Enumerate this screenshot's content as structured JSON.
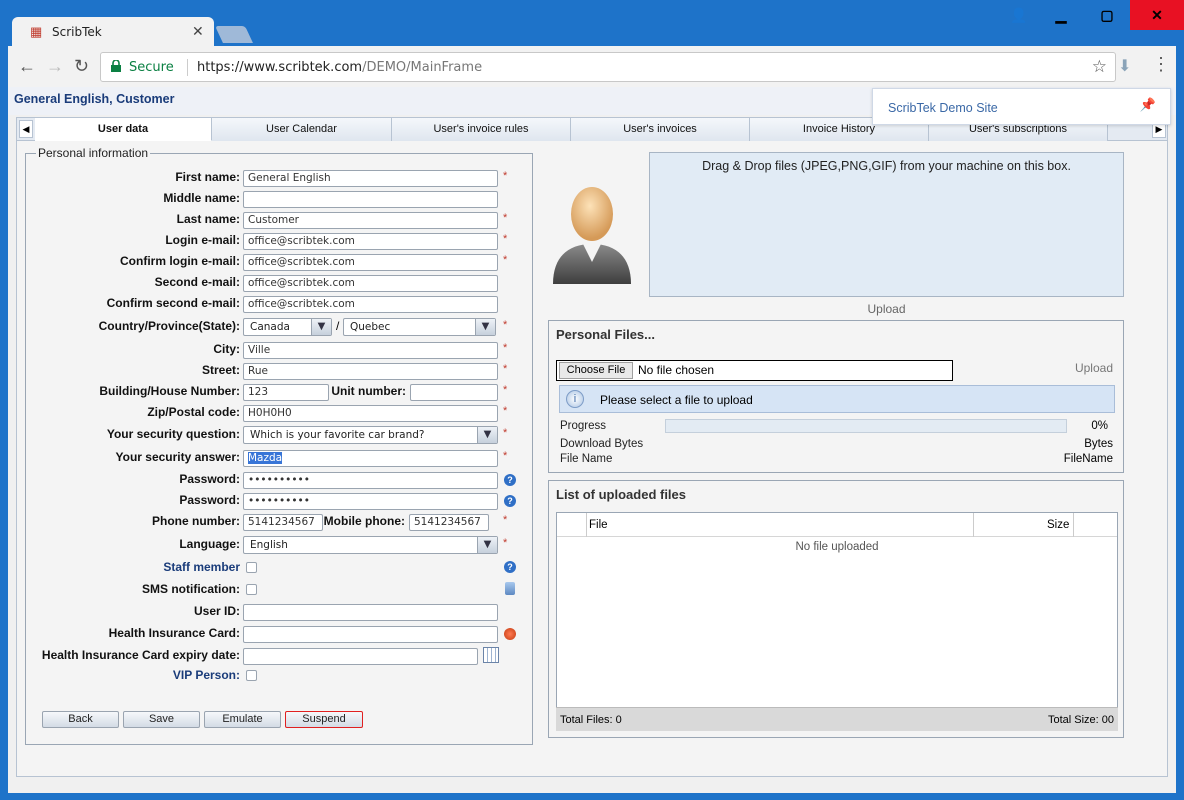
{
  "browser": {
    "tab_title": "ScribTek",
    "secure_label": "Secure",
    "url_host": "https://www.scribtek.com",
    "url_path": "/DEMO/MainFrame"
  },
  "header": {
    "user_title": "General English, Customer",
    "demo_site": "ScribTek Demo Site"
  },
  "tabs": [
    "User data",
    "User Calendar",
    "User's invoice rules",
    "User's invoices",
    "Invoice History",
    "User's subscriptions"
  ],
  "form": {
    "legend": "Personal information",
    "first_name_label": "First name:",
    "first_name": "General English",
    "middle_name_label": "Middle name:",
    "middle_name": "",
    "last_name_label": "Last name:",
    "last_name": "Customer",
    "login_email_label": "Login e-mail:",
    "login_email": "office@scribtek.com",
    "confirm_login_email_label": "Confirm login e-mail:",
    "confirm_login_email": "office@scribtek.com",
    "second_email_label": "Second e-mail:",
    "second_email": "office@scribtek.com",
    "confirm_second_email_label": "Confirm second e-mail:",
    "confirm_second_email": "office@scribtek.com",
    "country_label": "Country/Province(State):",
    "country": "Canada",
    "province_sep": "/",
    "province": "Quebec",
    "city_label": "City:",
    "city": "Ville",
    "street_label": "Street:",
    "street": "Rue",
    "building_label": "Building/House Number:",
    "building": "123",
    "unit_label": "Unit number:",
    "unit": "",
    "zip_label": "Zip/Postal code:",
    "zip": "H0H0H0",
    "security_question_label": "Your security question:",
    "security_question": "Which is your favorite car brand?",
    "security_answer_label": "Your security answer:",
    "security_answer": "Mazda",
    "password_label": "Password:",
    "password": "••••••••••",
    "password2_label": "Password:",
    "password2": "••••••••••",
    "phone_label": "Phone number:",
    "phone": "5141234567",
    "mobile_label": "Mobile phone:",
    "mobile": "5141234567",
    "language_label": "Language:",
    "language": "English",
    "staff_label": "Staff member",
    "sms_label": "SMS notification:",
    "user_id_label": "User ID:",
    "user_id": "",
    "health_card_label": "Health Insurance Card:",
    "health_card": "",
    "health_expiry_label": "Health Insurance Card expiry date:",
    "health_expiry": "",
    "vip_label": "VIP Person:",
    "required_mark": "*",
    "help_mark": "?"
  },
  "buttons": {
    "back": "Back",
    "save": "Save",
    "emulate": "Emulate",
    "suspend": "Suspend"
  },
  "upload": {
    "drop_text": "Drag & Drop files (JPEG,PNG,GIF) from your machine on this box.",
    "caption": "Upload"
  },
  "personal_files": {
    "title": "Personal Files...",
    "choose_file": "Choose File",
    "no_file": "No file chosen",
    "upload_link": "Upload",
    "info": "Please select a file to upload",
    "progress_label": "Progress",
    "progress_value": "0%",
    "progress_fraction": 0,
    "download_label": "Download Bytes",
    "download_value": "Bytes",
    "filename_label": "File Name",
    "filename_value": "FileName"
  },
  "uploaded": {
    "title": "List of uploaded files",
    "col_file": "File",
    "col_size": "Size",
    "empty": "No file uploaded",
    "total_files": "Total Files: 0",
    "total_size": "Total Size: 00"
  }
}
